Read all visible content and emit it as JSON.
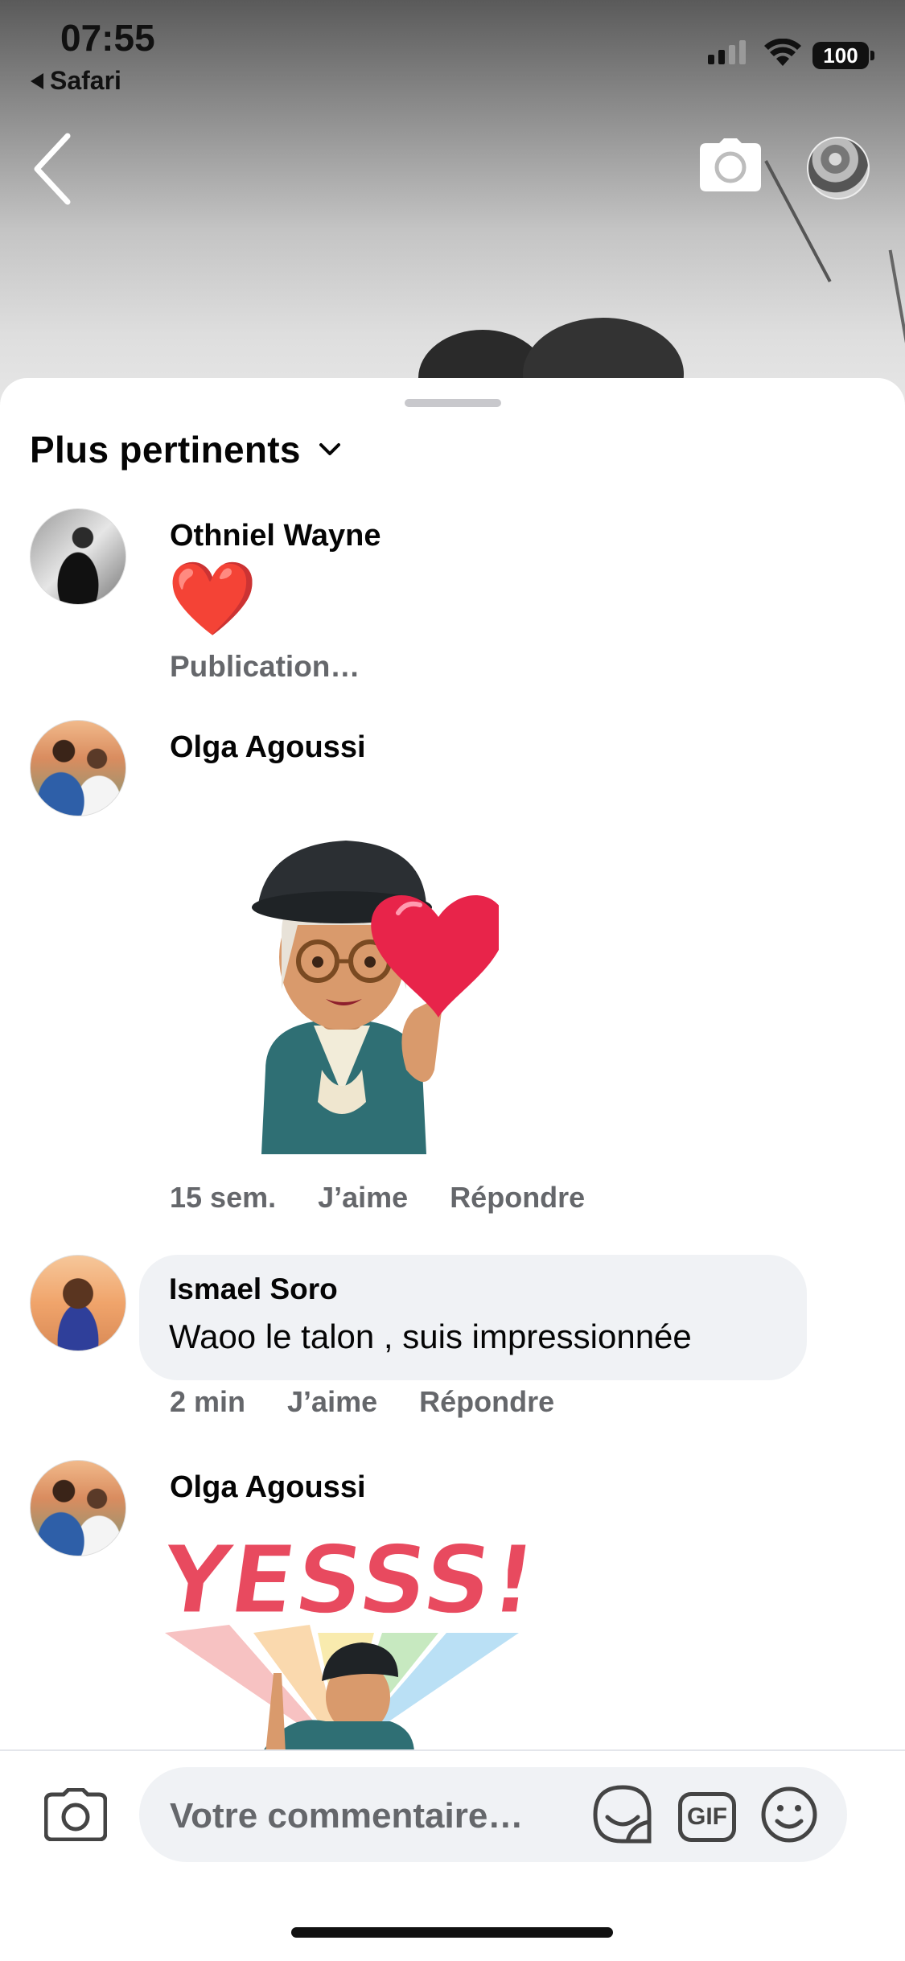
{
  "status_bar": {
    "time": "07:55",
    "back_app": "Safari",
    "battery": "100"
  },
  "header": {
    "back_icon": "chevron-left-icon",
    "camera_icon": "camera-icon",
    "profile_avatar": "avatar"
  },
  "comments_sheet": {
    "sort_label": "Plus pertinents",
    "sort_icon": "chevron-down-icon",
    "comments": [
      {
        "author": "Othniel Wayne",
        "content": "❤️",
        "meta": "Publication…"
      },
      {
        "author": "Olga Agoussi",
        "sticker": "heart-avatar-sticker",
        "time": "15 sem.",
        "like_label": "J’aime",
        "reply_label": "Répondre"
      },
      {
        "author": "Ismael Soro",
        "text": "Waoo le talon , suis impressionnée",
        "time": "2 min",
        "like_label": "J’aime",
        "reply_label": "Répondre"
      },
      {
        "author": "Olga Agoussi",
        "sticker_text": "YESSS!"
      }
    ]
  },
  "composer": {
    "placeholder": "Votre commentaire…",
    "gif_label": "GIF",
    "icons": [
      "camera-icon",
      "sticker-icon",
      "gif-icon",
      "emoji-icon"
    ]
  }
}
